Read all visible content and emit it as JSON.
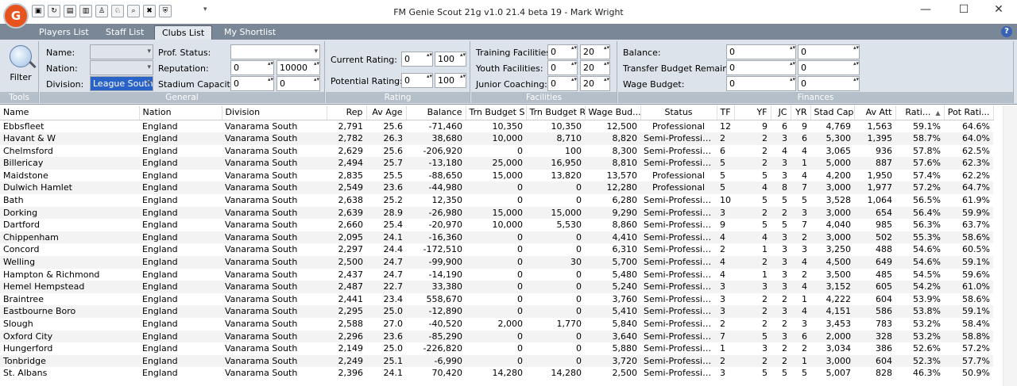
{
  "app": {
    "logo_text": "G",
    "title": "FM Genie Scout 21g v1.0 21.4 beta 19 - Mark Wright"
  },
  "window_controls": {
    "minimize": "—",
    "maximize": "☐",
    "close": "✕"
  },
  "quick_access_more": "▾",
  "tabs": [
    {
      "label": "Players List"
    },
    {
      "label": "Staff List"
    },
    {
      "label": "Clubs List"
    },
    {
      "label": "My Shortlist"
    }
  ],
  "help_label": "?",
  "ribbon": {
    "tools": {
      "filter_label": "Filter",
      "caption": "Tools"
    },
    "general": {
      "caption": "General",
      "name_label": "Name:",
      "nation_label": "Nation:",
      "division_label": "Division:",
      "division_value": "League South",
      "prof_status_label": "Prof. Status:",
      "reputation_label": "Reputation:",
      "reputation_min": "0",
      "reputation_max": "10000",
      "stadium_label": "Stadium Capacity:",
      "stadium_min": "0",
      "stadium_max": "0"
    },
    "rating": {
      "caption": "Rating",
      "current_label": "Current Rating:",
      "current_min": "0",
      "current_max": "100",
      "potential_label": "Potential Rating:",
      "potential_min": "0",
      "potential_max": "100"
    },
    "facilities": {
      "caption": "Facilities",
      "training_label": "Training Facilities:",
      "training_min": "0",
      "training_max": "20",
      "youth_label": "Youth Facilities:",
      "youth_min": "0",
      "youth_max": "20",
      "junior_label": "Junior Coaching:",
      "junior_min": "0",
      "junior_max": "20"
    },
    "finances": {
      "caption": "Finances",
      "balance_label": "Balance:",
      "balance_min": "0",
      "balance_max": "0",
      "transfer_label": "Transfer Budget Remaining:",
      "transfer_min": "0",
      "transfer_max": "0",
      "wage_label": "Wage Budget:",
      "wage_min": "0",
      "wage_max": "0"
    }
  },
  "table": {
    "columns": [
      "Name",
      "Nation",
      "Division",
      "Rep",
      "Av Age",
      "Balance",
      "Trn Budget S",
      "Trn Budget R",
      "Wage Bud...",
      "Status",
      "TF",
      "YF",
      "JC",
      "YR",
      "Stad Cap",
      "Av Att",
      "Rati...",
      "Pot Rati..."
    ],
    "sort_indicator": "▲",
    "rows": [
      [
        "Ebbsfleet",
        "England",
        "Vanarama South",
        "2,791",
        "25.6",
        "-71,460",
        "10,350",
        "10,350",
        "12,500",
        "Professional",
        "12",
        "9",
        "6",
        "9",
        "4,769",
        "1,563",
        "59.1%",
        "64.6%"
      ],
      [
        "Havant & W",
        "England",
        "Vanarama South",
        "2,782",
        "26.3",
        "38,680",
        "10,000",
        "8,710",
        "8,820",
        "Semi-Professio...",
        "2",
        "2",
        "3",
        "6",
        "5,300",
        "1,395",
        "58.7%",
        "64.0%"
      ],
      [
        "Chelmsford",
        "England",
        "Vanarama South",
        "2,629",
        "25.6",
        "-206,920",
        "0",
        "100",
        "8,300",
        "Semi-Professio...",
        "6",
        "2",
        "4",
        "4",
        "3,065",
        "936",
        "57.8%",
        "62.5%"
      ],
      [
        "Billericay",
        "England",
        "Vanarama South",
        "2,494",
        "25.7",
        "-13,180",
        "25,000",
        "16,950",
        "8,810",
        "Semi-Professio...",
        "5",
        "2",
        "3",
        "1",
        "5,000",
        "887",
        "57.6%",
        "62.3%"
      ],
      [
        "Maidstone",
        "England",
        "Vanarama South",
        "2,835",
        "25.5",
        "-88,650",
        "15,000",
        "13,820",
        "13,570",
        "Professional",
        "5",
        "5",
        "3",
        "4",
        "4,200",
        "1,950",
        "57.4%",
        "62.2%"
      ],
      [
        "Dulwich Hamlet",
        "England",
        "Vanarama South",
        "2,549",
        "23.6",
        "-44,980",
        "0",
        "0",
        "12,280",
        "Professional",
        "5",
        "4",
        "8",
        "7",
        "3,000",
        "1,977",
        "57.2%",
        "64.7%"
      ],
      [
        "Bath",
        "England",
        "Vanarama South",
        "2,638",
        "25.2",
        "12,350",
        "0",
        "0",
        "6,280",
        "Semi-Professio...",
        "10",
        "5",
        "5",
        "5",
        "3,528",
        "1,064",
        "56.5%",
        "61.9%"
      ],
      [
        "Dorking",
        "England",
        "Vanarama South",
        "2,639",
        "28.9",
        "-26,980",
        "15,000",
        "15,000",
        "9,290",
        "Semi-Professio...",
        "3",
        "2",
        "2",
        "3",
        "3,000",
        "654",
        "56.4%",
        "59.9%"
      ],
      [
        "Dartford",
        "England",
        "Vanarama South",
        "2,660",
        "25.4",
        "-20,970",
        "10,000",
        "5,530",
        "8,860",
        "Semi-Professio...",
        "9",
        "5",
        "5",
        "7",
        "4,040",
        "985",
        "56.3%",
        "63.7%"
      ],
      [
        "Chippenham",
        "England",
        "Vanarama South",
        "2,095",
        "24.1",
        "-16,360",
        "0",
        "0",
        "4,410",
        "Semi-Professio...",
        "4",
        "4",
        "3",
        "2",
        "3,000",
        "502",
        "55.3%",
        "58.6%"
      ],
      [
        "Concord",
        "England",
        "Vanarama South",
        "2,297",
        "24.4",
        "-172,510",
        "0",
        "0",
        "6,310",
        "Semi-Professio...",
        "2",
        "1",
        "3",
        "3",
        "3,250",
        "488",
        "54.6%",
        "60.5%"
      ],
      [
        "Welling",
        "England",
        "Vanarama South",
        "2,500",
        "24.7",
        "-99,900",
        "0",
        "30",
        "5,700",
        "Semi-Professio...",
        "4",
        "2",
        "3",
        "4",
        "4,500",
        "649",
        "54.6%",
        "59.1%"
      ],
      [
        "Hampton & Richmond",
        "England",
        "Vanarama South",
        "2,437",
        "24.7",
        "-14,190",
        "0",
        "0",
        "5,480",
        "Semi-Professio...",
        "4",
        "1",
        "3",
        "2",
        "3,500",
        "485",
        "54.5%",
        "59.6%"
      ],
      [
        "Hemel Hempstead",
        "England",
        "Vanarama South",
        "2,487",
        "22.7",
        "33,380",
        "0",
        "0",
        "5,240",
        "Semi-Professio...",
        "3",
        "3",
        "3",
        "4",
        "3,152",
        "605",
        "54.2%",
        "61.0%"
      ],
      [
        "Braintree",
        "England",
        "Vanarama South",
        "2,441",
        "23.4",
        "558,670",
        "0",
        "0",
        "3,760",
        "Semi-Professio...",
        "3",
        "2",
        "2",
        "1",
        "4,222",
        "604",
        "53.9%",
        "58.6%"
      ],
      [
        "Eastbourne Boro",
        "England",
        "Vanarama South",
        "2,295",
        "25.0",
        "-12,890",
        "0",
        "0",
        "5,410",
        "Semi-Professio...",
        "3",
        "2",
        "3",
        "4",
        "4,151",
        "586",
        "53.8%",
        "59.1%"
      ],
      [
        "Slough",
        "England",
        "Vanarama South",
        "2,588",
        "27.0",
        "-40,520",
        "2,000",
        "1,770",
        "5,840",
        "Semi-Professio...",
        "2",
        "2",
        "2",
        "3",
        "3,453",
        "783",
        "53.2%",
        "58.4%"
      ],
      [
        "Oxford City",
        "England",
        "Vanarama South",
        "2,296",
        "23.6",
        "-85,290",
        "0",
        "0",
        "3,640",
        "Semi-Professio...",
        "7",
        "5",
        "3",
        "6",
        "2,000",
        "328",
        "53.2%",
        "58.8%"
      ],
      [
        "Hungerford",
        "England",
        "Vanarama South",
        "2,149",
        "25.0",
        "-226,820",
        "0",
        "0",
        "5,880",
        "Semi-Professio...",
        "1",
        "3",
        "2",
        "2",
        "3,034",
        "386",
        "52.6%",
        "57.2%"
      ],
      [
        "Tonbridge",
        "England",
        "Vanarama South",
        "2,249",
        "25.1",
        "-6,990",
        "0",
        "0",
        "3,720",
        "Semi-Professio...",
        "2",
        "2",
        "2",
        "1",
        "3,000",
        "604",
        "52.3%",
        "57.7%"
      ],
      [
        "St. Albans",
        "England",
        "Vanarama South",
        "2,396",
        "24.1",
        "70,420",
        "14,280",
        "14,280",
        "2,500",
        "Semi-Professio...",
        "3",
        "5",
        "5",
        "5",
        "5,007",
        "828",
        "46.3%",
        "50.9%"
      ]
    ]
  }
}
